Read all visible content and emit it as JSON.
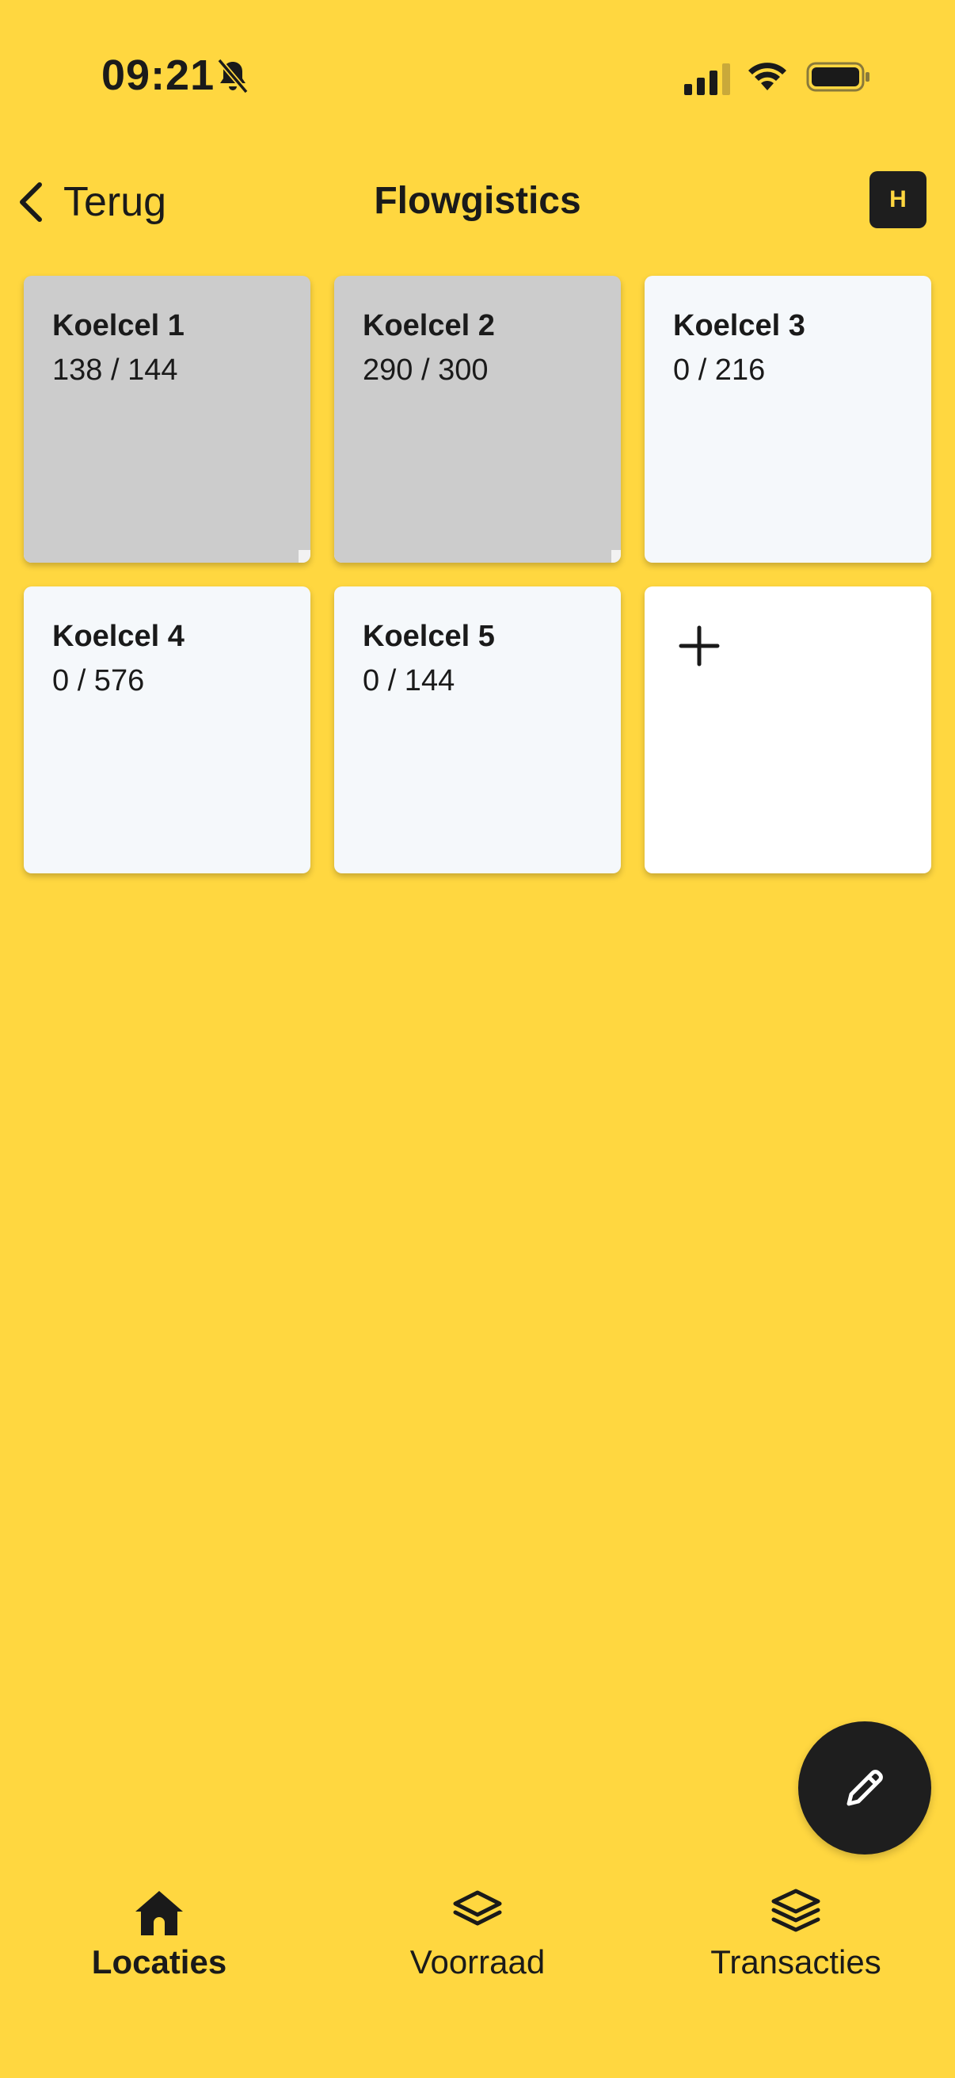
{
  "status_bar": {
    "time": "09:21"
  },
  "header": {
    "back_label": "Terug",
    "title": "Flowgistics",
    "avatar_initial": "H"
  },
  "locations": [
    {
      "name": "Koelcel 1",
      "count": "138 / 144",
      "fill": 0.958,
      "state": "full"
    },
    {
      "name": "Koelcel 2",
      "count": "290 / 300",
      "fill": 0.967,
      "state": "full"
    },
    {
      "name": "Koelcel 3",
      "count": "0 / 216",
      "fill": 0,
      "state": "empty"
    },
    {
      "name": "Koelcel 4",
      "count": "0 / 576",
      "fill": 0,
      "state": "empty"
    },
    {
      "name": "Koelcel 5",
      "count": "0 / 144",
      "fill": 0,
      "state": "empty"
    }
  ],
  "add_card": {
    "icon": "plus-icon"
  },
  "fab": {
    "icon": "pencil-icon"
  },
  "nav": {
    "items": [
      {
        "label": "Locaties",
        "icon": "home-icon",
        "active": true
      },
      {
        "label": "Voorraad",
        "icon": "layers-icon",
        "active": false
      },
      {
        "label": "Transacties",
        "icon": "layers-icon",
        "active": false
      }
    ]
  },
  "colors": {
    "background": "#FFD740",
    "dark": "#1E1E1E",
    "card_full": "#CCCCCC",
    "card_empty": "#F5F8FB",
    "card_add": "#FFFFFF"
  }
}
